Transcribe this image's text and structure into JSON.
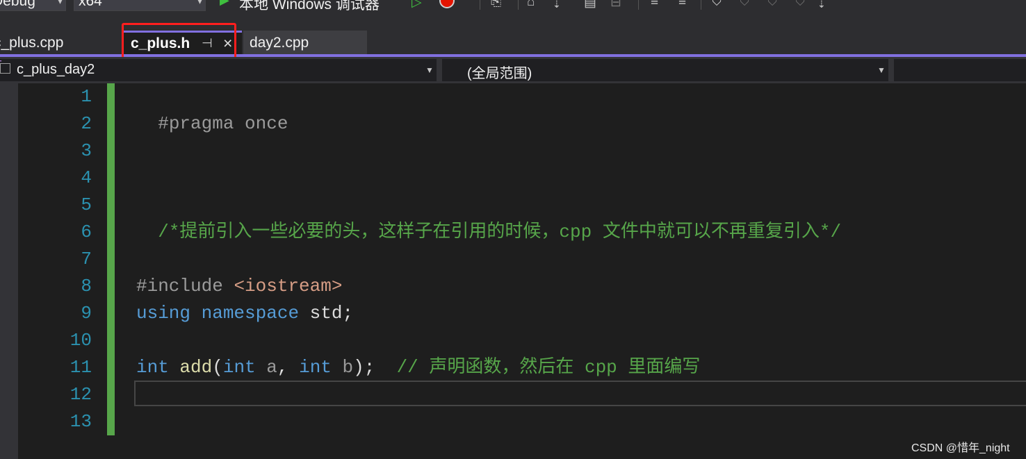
{
  "toolbar": {
    "configuration": "Debug",
    "platform": "x64",
    "debugger_label": "本地 Windows 调试器"
  },
  "tabs": [
    {
      "label": "c_plus.cpp",
      "active": false
    },
    {
      "label": "c_plus.h",
      "active": true
    },
    {
      "label": "day2.cpp",
      "active": false
    }
  ],
  "nav": {
    "project": "c_plus_day2",
    "scope": "(全局范围)"
  },
  "editor": {
    "line_numbers": [
      "1",
      "2",
      "3",
      "4",
      "5",
      "6",
      "7",
      "8",
      "9",
      "10",
      "11",
      "12",
      "13"
    ],
    "lines": {
      "l1": {
        "directive": "#pragma once"
      },
      "l5": {
        "comment": "/*提前引入一些必要的头，这样子在引用的时候，cpp 文件中就可以不再重复引入*/"
      },
      "l8": {
        "directive": "#include ",
        "header": "<iostream>"
      },
      "l9": {
        "kw1": "using",
        "kw2": "namespace",
        "rest": " std;"
      },
      "l11": {
        "kw_int1": "int",
        "fn": "add",
        "open": "(",
        "kw_int2": "int",
        "param_a": " a",
        "comma": ", ",
        "kw_int3": "int",
        "param_b": " b",
        "close": ");",
        "comment": "// 声明函数，然后在 cpp 里面编写"
      }
    }
  },
  "watermark": "CSDN @惜年_night",
  "colors": {
    "accent": "#8170e0",
    "highlight": "#ff1e1e",
    "change_bar": "#57a64a",
    "keyword": "#569cd6",
    "comment": "#57a64a",
    "line_number": "#2b91af"
  }
}
